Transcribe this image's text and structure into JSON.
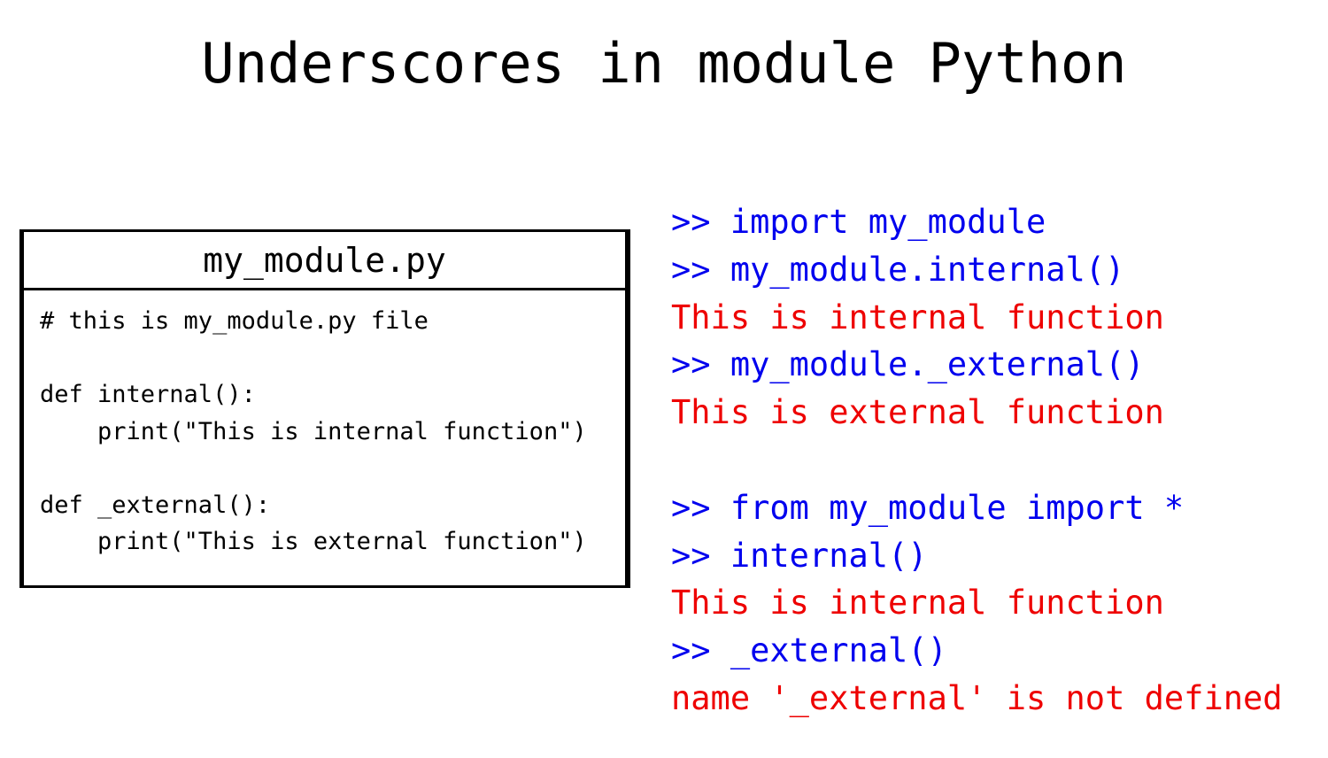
{
  "title": "Underscores in module Python",
  "code_box": {
    "filename": "my_module.py",
    "lines": [
      "# this is my_module.py file",
      "",
      "def internal():",
      "    print(\"This is internal function\")",
      "",
      "def _external():",
      "    print(\"This is external function\")"
    ]
  },
  "console": {
    "lines": [
      {
        "kind": "cmd",
        "text": ">> import my_module"
      },
      {
        "kind": "cmd",
        "text": ">> my_module.internal()"
      },
      {
        "kind": "out",
        "text": "This is internal function"
      },
      {
        "kind": "cmd",
        "text": ">> my_module._external()"
      },
      {
        "kind": "out",
        "text": "This is external function"
      },
      {
        "kind": "blank",
        "text": ""
      },
      {
        "kind": "cmd",
        "text": ">> from my_module import *"
      },
      {
        "kind": "cmd",
        "text": ">> internal()"
      },
      {
        "kind": "out",
        "text": "This is internal function"
      },
      {
        "kind": "cmd",
        "text": ">> _external()"
      },
      {
        "kind": "out",
        "text": "name '_external' is not defined"
      }
    ]
  },
  "colors": {
    "command": "#0000ee",
    "output": "#ee0000",
    "text": "#000000",
    "background": "#ffffff"
  }
}
